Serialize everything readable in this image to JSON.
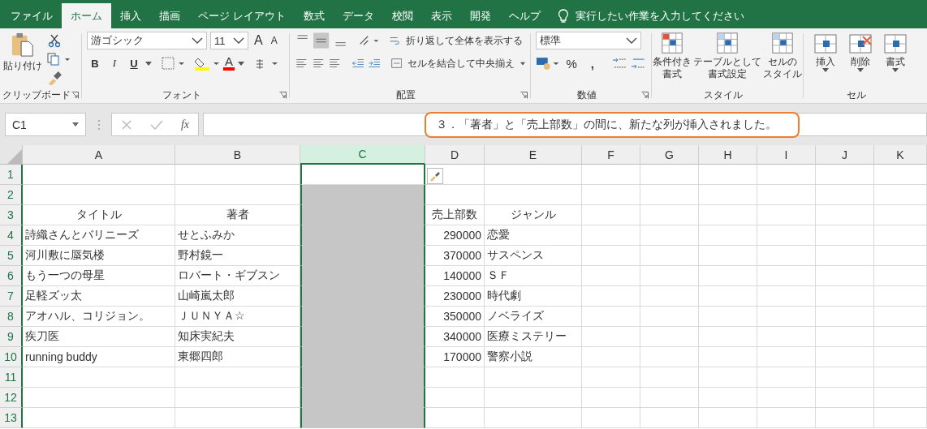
{
  "tabs": [
    {
      "label": "ファイル",
      "selected": false
    },
    {
      "label": "ホーム",
      "selected": true
    },
    {
      "label": "挿入",
      "selected": false
    },
    {
      "label": "描画",
      "selected": false
    },
    {
      "label": "ページ レイアウト",
      "selected": false
    },
    {
      "label": "数式",
      "selected": false
    },
    {
      "label": "データ",
      "selected": false
    },
    {
      "label": "校閲",
      "selected": false
    },
    {
      "label": "表示",
      "selected": false
    },
    {
      "label": "開発",
      "selected": false
    },
    {
      "label": "ヘルプ",
      "selected": false
    }
  ],
  "tell_me": "実行したい作業を入力してください",
  "clipboard": {
    "paste": "貼り付け",
    "group": "クリップボード"
  },
  "font": {
    "name": "游ゴシック",
    "size": "11",
    "grow": "A",
    "shrink": "A",
    "styles": [
      "B",
      "I",
      "U"
    ],
    "color_glyph": "A",
    "group": "フォント"
  },
  "alignment": {
    "wrap": "折り返して全体を表示する",
    "merge": "セルを結合して中央揃え",
    "group": "配置"
  },
  "number": {
    "format": "標準",
    "percent": "%",
    "comma": ",",
    "group": "数値"
  },
  "styles": {
    "buttons": [
      {
        "lines": [
          "条件付き",
          "書式"
        ]
      },
      {
        "lines": [
          "テーブルとして",
          "書式設定"
        ]
      },
      {
        "lines": [
          "セルの",
          "スタイル"
        ]
      }
    ],
    "group": "スタイル"
  },
  "cells": {
    "buttons": [
      "挿入",
      "削除",
      "書式"
    ],
    "group": "セル"
  },
  "name_box": "C1",
  "function_button": "fx",
  "callout": "３．「著者」と「売上部数」の間に、新たな列が挿入されました。",
  "columns": [
    {
      "label": "A",
      "selected": false
    },
    {
      "label": "B",
      "selected": false
    },
    {
      "label": "C",
      "selected": true
    },
    {
      "label": "D",
      "selected": false
    },
    {
      "label": "E",
      "selected": false
    },
    {
      "label": "F",
      "selected": false
    },
    {
      "label": "G",
      "selected": false
    },
    {
      "label": "H",
      "selected": false
    },
    {
      "label": "I",
      "selected": false
    },
    {
      "label": "J",
      "selected": false
    },
    {
      "label": "K",
      "selected": false
    }
  ],
  "rows": [
    {
      "label": "1",
      "kind": "data"
    },
    {
      "label": "2",
      "kind": "data"
    },
    {
      "label": "3",
      "kind": "header",
      "cells": [
        {
          "text": "タイトル"
        },
        {
          "text": "著者"
        },
        {
          "text": "売上部数"
        },
        {
          "text": "ジャンル"
        }
      ]
    },
    {
      "label": "4",
      "kind": "data",
      "cells": [
        {
          "text": "詩織さんとバリニーズ"
        },
        {
          "text": "せとふみか"
        },
        {
          "text": "290000",
          "kind": "number"
        },
        {
          "text": "恋愛"
        }
      ]
    },
    {
      "label": "5",
      "kind": "data",
      "cells": [
        {
          "text": "河川敷に蜃気楼"
        },
        {
          "text": "野村鏡一"
        },
        {
          "text": "370000",
          "kind": "number"
        },
        {
          "text": "サスペンス"
        }
      ]
    },
    {
      "label": "6",
      "kind": "data",
      "cells": [
        {
          "text": "もう一つの母星"
        },
        {
          "text": "ロバート・ギブスン"
        },
        {
          "text": "140000",
          "kind": "number"
        },
        {
          "text": "ＳＦ"
        }
      ]
    },
    {
      "label": "7",
      "kind": "data",
      "cells": [
        {
          "text": "足軽ズッ太"
        },
        {
          "text": "山崎嵐太郎"
        },
        {
          "text": "230000",
          "kind": "number"
        },
        {
          "text": "時代劇"
        }
      ]
    },
    {
      "label": "8",
      "kind": "data",
      "cells": [
        {
          "text": "アオハル、コリジョン。"
        },
        {
          "text": "ＪＵＮＹＡ☆"
        },
        {
          "text": "350000",
          "kind": "number"
        },
        {
          "text": "ノベライズ"
        }
      ]
    },
    {
      "label": "9",
      "kind": "data",
      "cells": [
        {
          "text": "疾刀医"
        },
        {
          "text": "知床実紀夫"
        },
        {
          "text": "340000",
          "kind": "number"
        },
        {
          "text": "医療ミステリー"
        }
      ]
    },
    {
      "label": "10",
      "kind": "data",
      "cells": [
        {
          "text": "running buddy"
        },
        {
          "text": "東郷四郎"
        },
        {
          "text": "170000",
          "kind": "number"
        },
        {
          "text": "警察小説"
        }
      ]
    },
    {
      "label": "11",
      "kind": "data"
    },
    {
      "label": "12",
      "kind": "data"
    },
    {
      "label": "13",
      "kind": "data"
    }
  ]
}
